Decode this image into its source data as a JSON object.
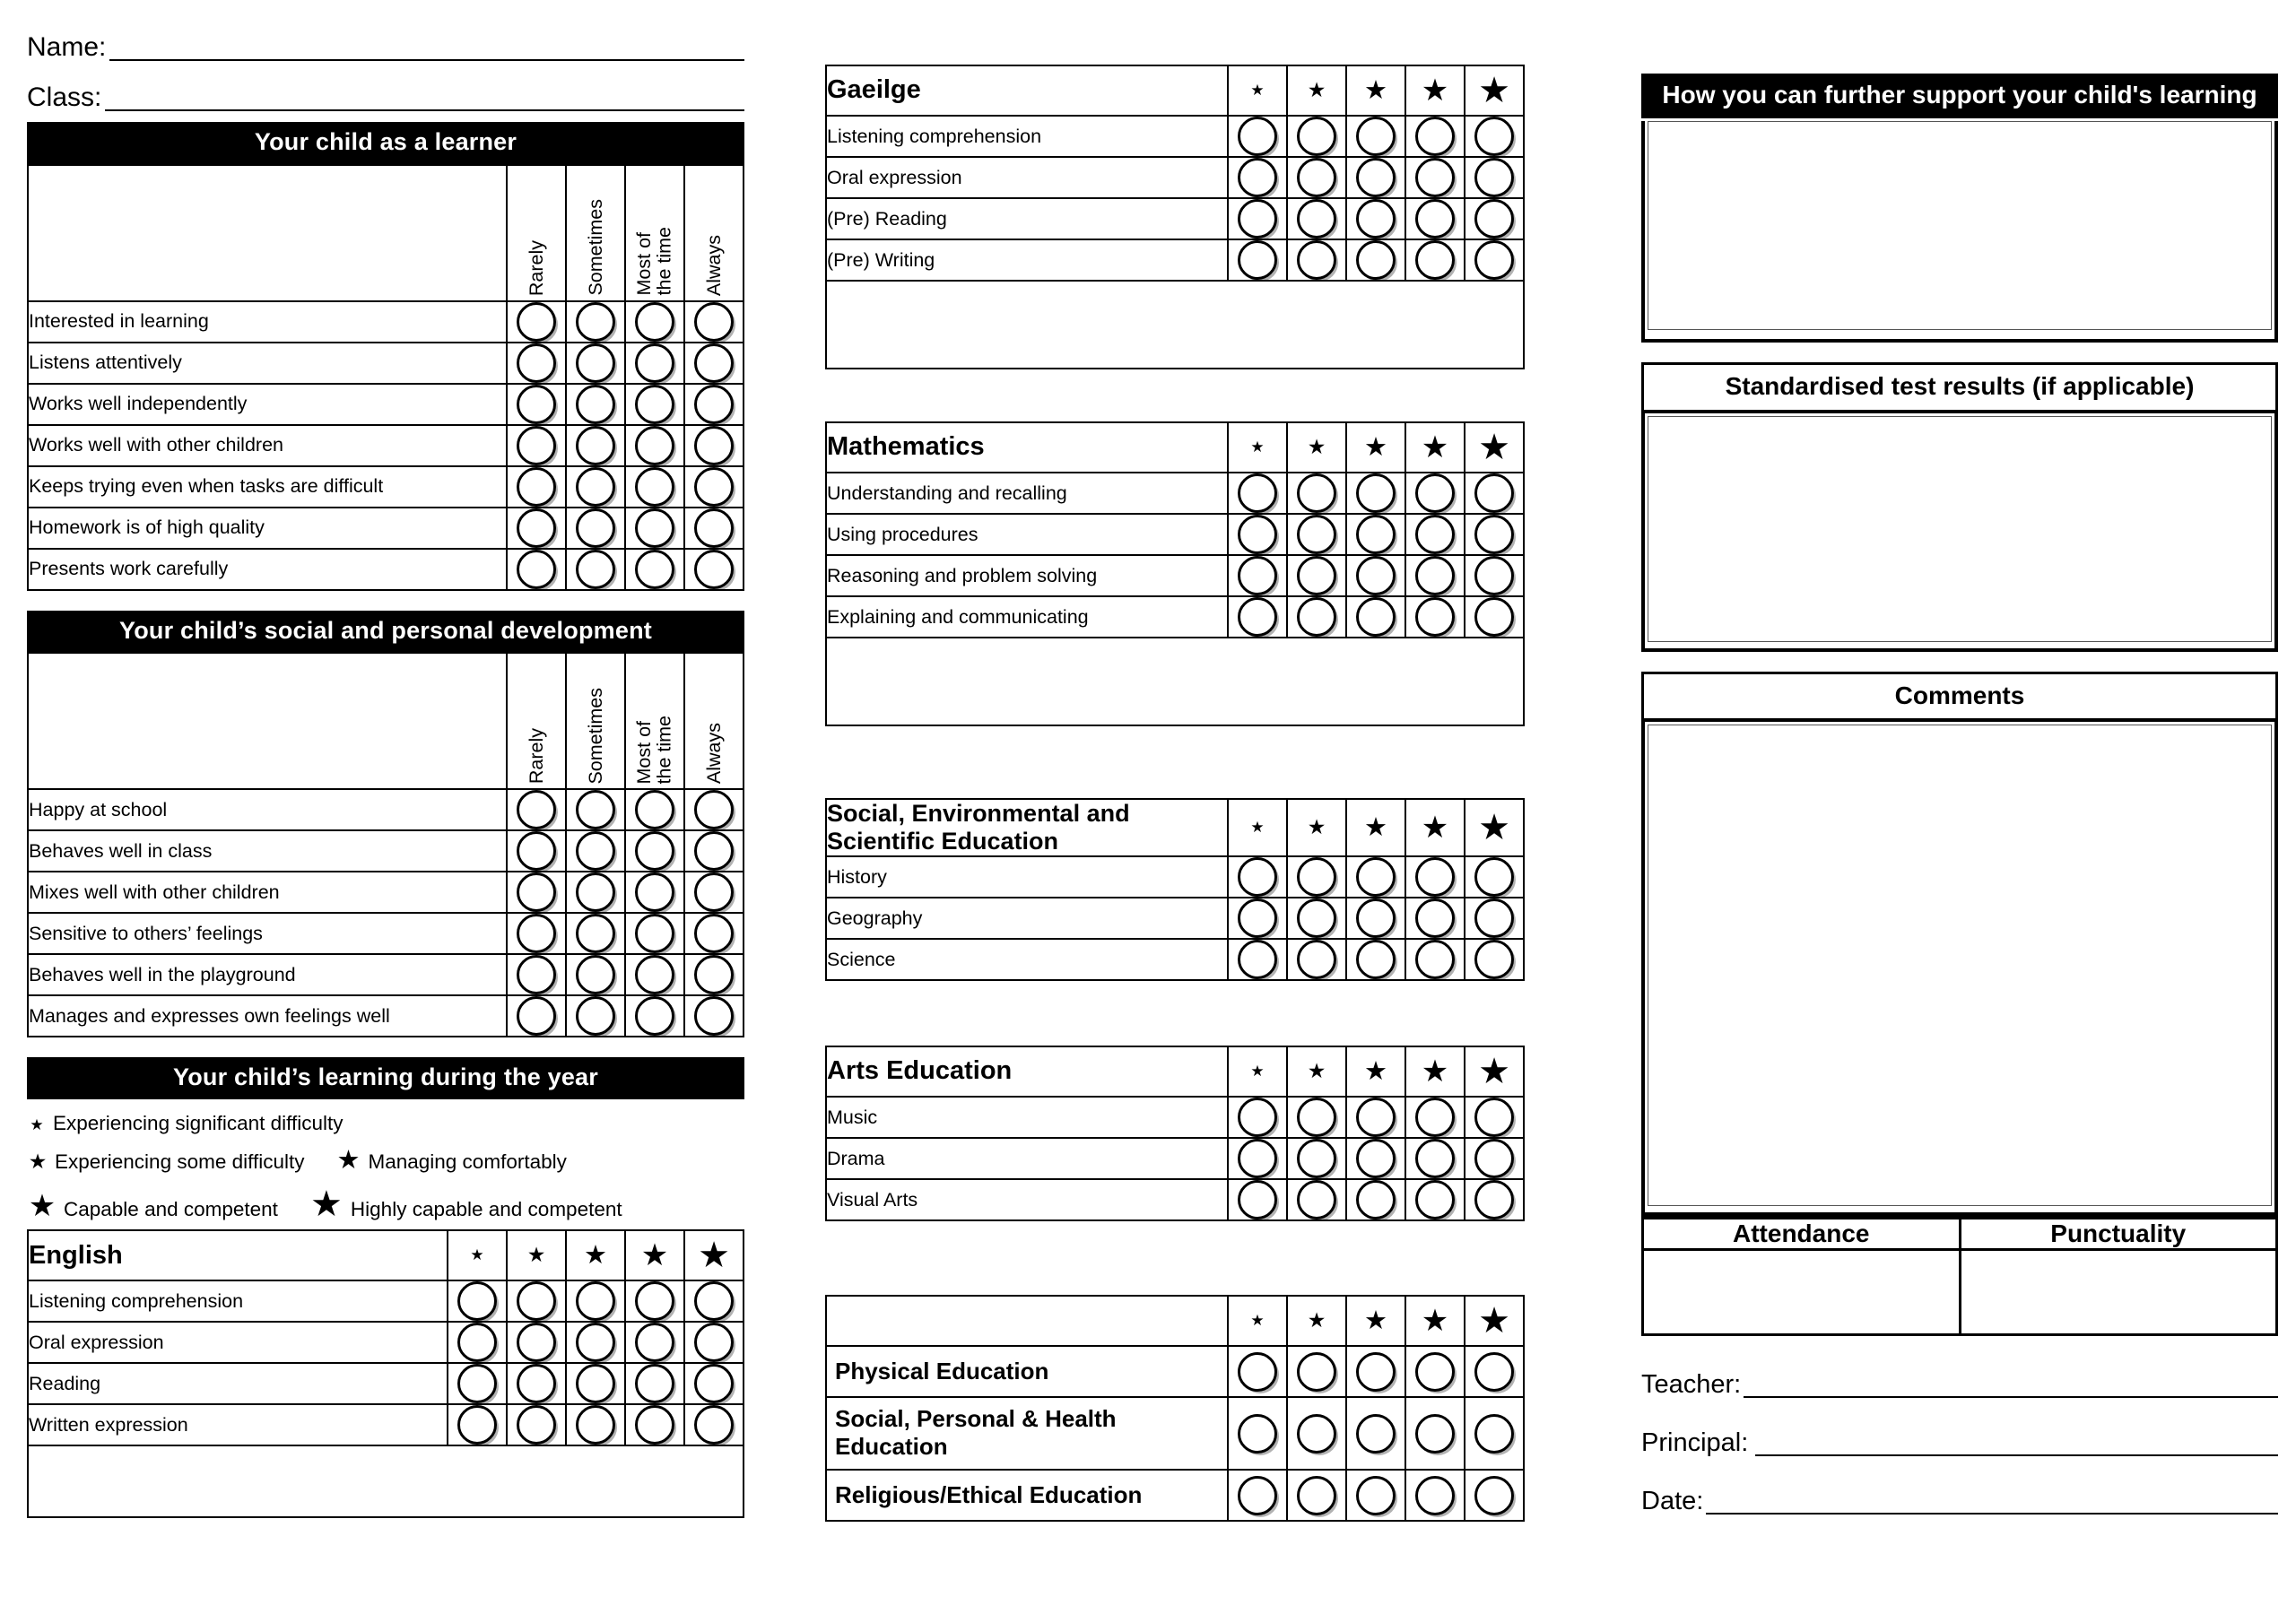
{
  "header": {
    "name_label": "Name:",
    "class_label": "Class:"
  },
  "learner_section": {
    "banner": "Your child as a learner",
    "scale_headers": [
      "Rarely",
      "Sometimes",
      "Most of\nthe time",
      "Always"
    ],
    "rows": [
      "Interested in learning",
      "Listens attentively",
      "Works well independently",
      "Works well with other children",
      "Keeps trying even when tasks are difficult",
      "Homework is of high quality",
      "Presents work carefully"
    ]
  },
  "social_section": {
    "banner": "Your child’s social and personal development",
    "scale_headers": [
      "Rarely",
      "Sometimes",
      "Most of\nthe time",
      "Always"
    ],
    "rows": [
      "Happy at school",
      "Behaves well in class",
      "Mixes well with other children",
      "Sensitive to others’ feelings",
      "Behaves well in the playground",
      "Manages and expresses own feelings well"
    ]
  },
  "learning_year": {
    "banner": "Your child’s learning during the year",
    "legend": [
      {
        "star": "★",
        "size": 1,
        "label": "Experiencing significant difficulty"
      },
      {
        "star": "★",
        "size": 2,
        "label": "Experiencing some difficulty"
      },
      {
        "star": "★",
        "size": 3,
        "label": "Managing comfortably"
      },
      {
        "star": "★",
        "size": 4,
        "label": "Capable and competent"
      },
      {
        "star": "★",
        "size": 5,
        "label": "Highly capable and competent"
      }
    ]
  },
  "subjects": [
    {
      "id": "english",
      "title": "English",
      "bold_rows": false,
      "rows": [
        "Listening comprehension",
        "Oral expression",
        "Reading",
        "Written expression"
      ],
      "trailing_blank": true
    },
    {
      "id": "gaeilge",
      "title": "Gaeilge",
      "bold_rows": false,
      "rows": [
        "Listening comprehension",
        "Oral expression",
        "(Pre) Reading",
        "(Pre) Writing"
      ],
      "trailing_blank": true
    },
    {
      "id": "mathematics",
      "title": "Mathematics",
      "bold_rows": false,
      "rows": [
        "Understanding and recalling",
        "Using procedures",
        "Reasoning and problem solving",
        "Explaining and communicating"
      ],
      "trailing_blank": true
    },
    {
      "id": "sese",
      "title": "Social, Environmental and Scientific Education",
      "bold_rows": false,
      "rows": [
        "History",
        "Geography",
        "Science"
      ],
      "trailing_blank": false
    },
    {
      "id": "arts",
      "title": "Arts Education",
      "bold_rows": false,
      "rows": [
        "Music",
        "Drama",
        "Visual Arts"
      ],
      "trailing_blank": false
    },
    {
      "id": "other",
      "title": "",
      "bold_rows": true,
      "rows": [
        "Physical Education",
        "Social, Personal & Health Education",
        "Religious/Ethical Education"
      ],
      "trailing_blank": false
    }
  ],
  "star_scale": [
    1,
    2,
    3,
    4,
    5
  ],
  "star_glyph": "★",
  "right": {
    "support_banner": "How you can further support your child's learning",
    "standardised_header": "Standardised test results (if applicable)",
    "comments_header": "Comments",
    "attendance_header": "Attendance",
    "punctuality_header": "Punctuality",
    "teacher_label": "Teacher:",
    "principal_label": "Principal:",
    "date_label": "Date:"
  },
  "colors": {
    "banner_bg": "#000000",
    "banner_fg": "#ffffff",
    "rule": "#000000",
    "page_bg": "#ffffff"
  }
}
